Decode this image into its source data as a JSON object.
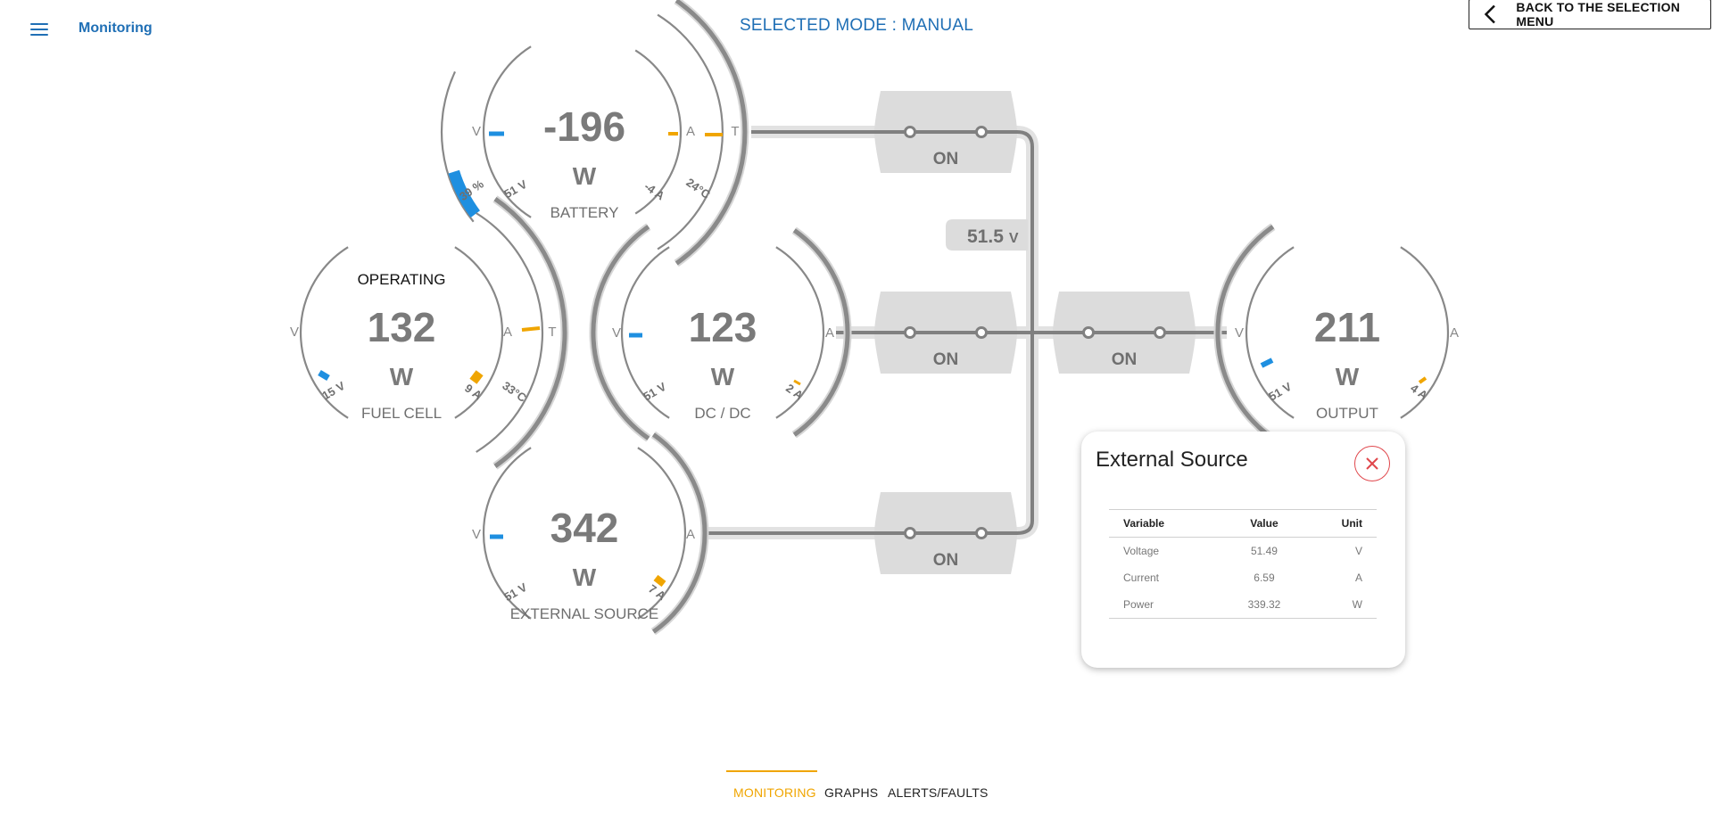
{
  "header": {
    "app_title": "Monitoring",
    "mode_title": "SELECTED MODE : MANUAL",
    "back_button": "BACK TO THE SELECTION MENU"
  },
  "bus": {
    "voltage_value": "51.5",
    "voltage_unit": "V"
  },
  "switch_label": "ON",
  "units": {
    "volt": "V",
    "amp": "A",
    "temp": "T",
    "power": "W"
  },
  "components": {
    "battery": {
      "label": "BATTERY",
      "power": "-196",
      "power_unit": "W",
      "soc_reading": "39 %",
      "voltage_reading": "51 V",
      "current_reading": "-4 A",
      "temp_reading": "24°C",
      "soc_level": 0.39
    },
    "fuel_cell": {
      "label": "FUEL CELL",
      "status": "OPERATING",
      "power": "132",
      "power_unit": "W",
      "voltage_reading": "15 V",
      "current_reading": "9 A",
      "temp_reading": "33°C"
    },
    "dcdc": {
      "label": "DC / DC",
      "power": "123",
      "power_unit": "W",
      "voltage_reading": "51 V",
      "current_reading": "2 A"
    },
    "external_source": {
      "label": "EXTERNAL SOURCE",
      "power": "342",
      "power_unit": "W",
      "voltage_reading": "51 V",
      "current_reading": "7 A"
    },
    "output": {
      "label": "OUTPUT",
      "power": "211",
      "power_unit": "W",
      "voltage_reading": "51 V",
      "current_reading": "4 A"
    }
  },
  "popup": {
    "title": "External Source",
    "columns": [
      "Variable",
      "Value",
      "Unit"
    ],
    "rows": [
      [
        "Voltage",
        "51.49",
        "V"
      ],
      [
        "Current",
        "6.59",
        "A"
      ],
      [
        "Power",
        "339.32",
        "W"
      ]
    ]
  },
  "tabs": [
    {
      "label": "MONITORING",
      "active": true
    },
    {
      "label": "GRAPHS",
      "active": false
    },
    {
      "label": "ALERTS/FAULTS",
      "active": false
    }
  ],
  "colors": {
    "accent_blue": "#1f6fb5",
    "gauge_blue": "#1e8fe0",
    "gauge_orange": "#f0a500",
    "wire_grey": "#808080",
    "close_red": "#e0474c"
  }
}
